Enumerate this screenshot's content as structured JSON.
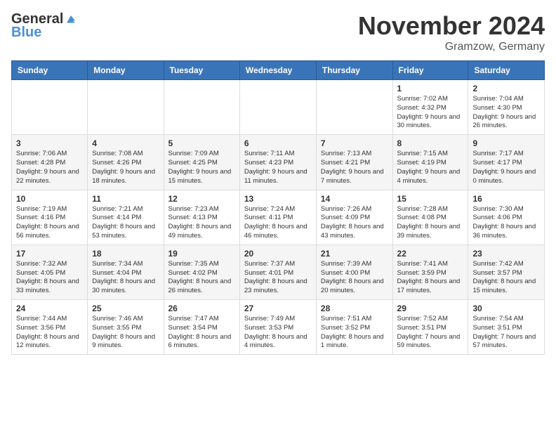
{
  "header": {
    "logo_general": "General",
    "logo_blue": "Blue",
    "month_title": "November 2024",
    "location": "Gramzow, Germany"
  },
  "weekdays": [
    "Sunday",
    "Monday",
    "Tuesday",
    "Wednesday",
    "Thursday",
    "Friday",
    "Saturday"
  ],
  "weeks": [
    [
      {
        "day": "",
        "info": ""
      },
      {
        "day": "",
        "info": ""
      },
      {
        "day": "",
        "info": ""
      },
      {
        "day": "",
        "info": ""
      },
      {
        "day": "",
        "info": ""
      },
      {
        "day": "1",
        "info": "Sunrise: 7:02 AM\nSunset: 4:32 PM\nDaylight: 9 hours and 30 minutes."
      },
      {
        "day": "2",
        "info": "Sunrise: 7:04 AM\nSunset: 4:30 PM\nDaylight: 9 hours and 26 minutes."
      }
    ],
    [
      {
        "day": "3",
        "info": "Sunrise: 7:06 AM\nSunset: 4:28 PM\nDaylight: 9 hours and 22 minutes."
      },
      {
        "day": "4",
        "info": "Sunrise: 7:08 AM\nSunset: 4:26 PM\nDaylight: 9 hours and 18 minutes."
      },
      {
        "day": "5",
        "info": "Sunrise: 7:09 AM\nSunset: 4:25 PM\nDaylight: 9 hours and 15 minutes."
      },
      {
        "day": "6",
        "info": "Sunrise: 7:11 AM\nSunset: 4:23 PM\nDaylight: 9 hours and 11 minutes."
      },
      {
        "day": "7",
        "info": "Sunrise: 7:13 AM\nSunset: 4:21 PM\nDaylight: 9 hours and 7 minutes."
      },
      {
        "day": "8",
        "info": "Sunrise: 7:15 AM\nSunset: 4:19 PM\nDaylight: 9 hours and 4 minutes."
      },
      {
        "day": "9",
        "info": "Sunrise: 7:17 AM\nSunset: 4:17 PM\nDaylight: 9 hours and 0 minutes."
      }
    ],
    [
      {
        "day": "10",
        "info": "Sunrise: 7:19 AM\nSunset: 4:16 PM\nDaylight: 8 hours and 56 minutes."
      },
      {
        "day": "11",
        "info": "Sunrise: 7:21 AM\nSunset: 4:14 PM\nDaylight: 8 hours and 53 minutes."
      },
      {
        "day": "12",
        "info": "Sunrise: 7:23 AM\nSunset: 4:13 PM\nDaylight: 8 hours and 49 minutes."
      },
      {
        "day": "13",
        "info": "Sunrise: 7:24 AM\nSunset: 4:11 PM\nDaylight: 8 hours and 46 minutes."
      },
      {
        "day": "14",
        "info": "Sunrise: 7:26 AM\nSunset: 4:09 PM\nDaylight: 8 hours and 43 minutes."
      },
      {
        "day": "15",
        "info": "Sunrise: 7:28 AM\nSunset: 4:08 PM\nDaylight: 8 hours and 39 minutes."
      },
      {
        "day": "16",
        "info": "Sunrise: 7:30 AM\nSunset: 4:06 PM\nDaylight: 8 hours and 36 minutes."
      }
    ],
    [
      {
        "day": "17",
        "info": "Sunrise: 7:32 AM\nSunset: 4:05 PM\nDaylight: 8 hours and 33 minutes."
      },
      {
        "day": "18",
        "info": "Sunrise: 7:34 AM\nSunset: 4:04 PM\nDaylight: 8 hours and 30 minutes."
      },
      {
        "day": "19",
        "info": "Sunrise: 7:35 AM\nSunset: 4:02 PM\nDaylight: 8 hours and 26 minutes."
      },
      {
        "day": "20",
        "info": "Sunrise: 7:37 AM\nSunset: 4:01 PM\nDaylight: 8 hours and 23 minutes."
      },
      {
        "day": "21",
        "info": "Sunrise: 7:39 AM\nSunset: 4:00 PM\nDaylight: 8 hours and 20 minutes."
      },
      {
        "day": "22",
        "info": "Sunrise: 7:41 AM\nSunset: 3:59 PM\nDaylight: 8 hours and 17 minutes."
      },
      {
        "day": "23",
        "info": "Sunrise: 7:42 AM\nSunset: 3:57 PM\nDaylight: 8 hours and 15 minutes."
      }
    ],
    [
      {
        "day": "24",
        "info": "Sunrise: 7:44 AM\nSunset: 3:56 PM\nDaylight: 8 hours and 12 minutes."
      },
      {
        "day": "25",
        "info": "Sunrise: 7:46 AM\nSunset: 3:55 PM\nDaylight: 8 hours and 9 minutes."
      },
      {
        "day": "26",
        "info": "Sunrise: 7:47 AM\nSunset: 3:54 PM\nDaylight: 8 hours and 6 minutes."
      },
      {
        "day": "27",
        "info": "Sunrise: 7:49 AM\nSunset: 3:53 PM\nDaylight: 8 hours and 4 minutes."
      },
      {
        "day": "28",
        "info": "Sunrise: 7:51 AM\nSunset: 3:52 PM\nDaylight: 8 hours and 1 minute."
      },
      {
        "day": "29",
        "info": "Sunrise: 7:52 AM\nSunset: 3:51 PM\nDaylight: 7 hours and 59 minutes."
      },
      {
        "day": "30",
        "info": "Sunrise: 7:54 AM\nSunset: 3:51 PM\nDaylight: 7 hours and 57 minutes."
      }
    ]
  ]
}
